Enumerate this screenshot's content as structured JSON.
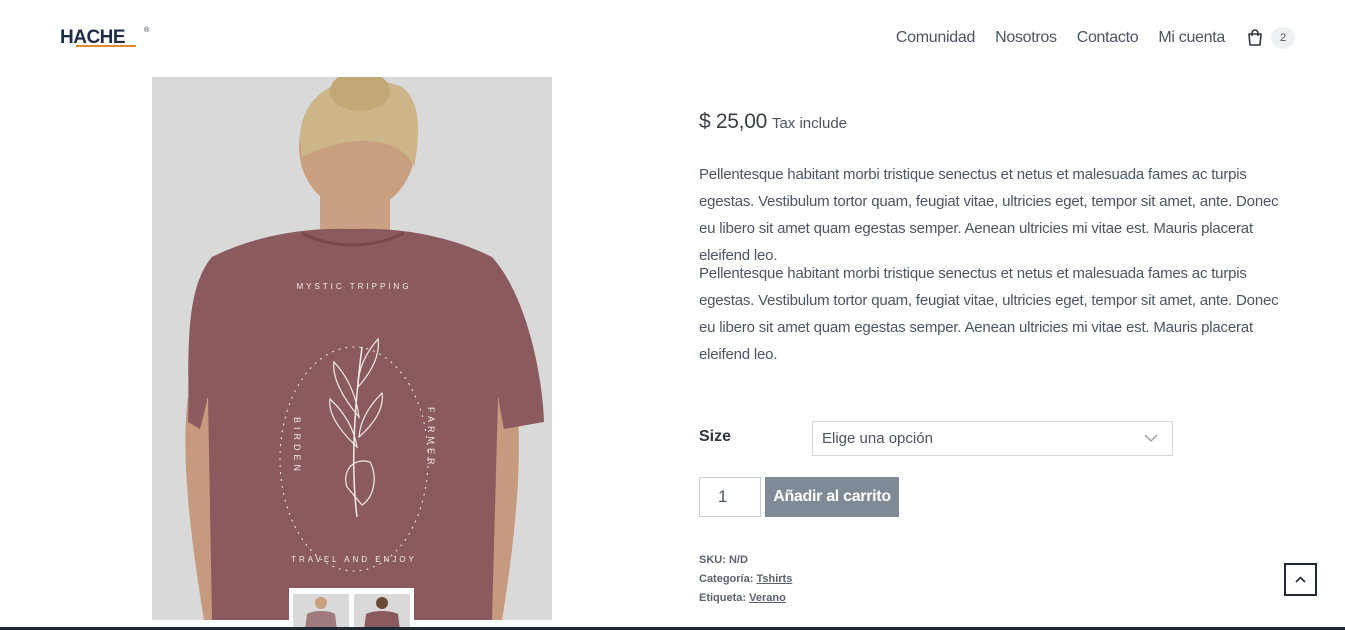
{
  "brand": {
    "logo_text": "HACHE",
    "logo_mark": "®"
  },
  "nav": {
    "items": [
      "Comunidad",
      "Nosotros",
      "Contacto",
      "Mi cuenta"
    ],
    "cart_count": "2",
    "cart_icon": "cart-icon"
  },
  "product": {
    "price": "$ 25,00",
    "tax_note": "Tax include",
    "description_1": "Pellentesque habitant morbi tristique senectus et netus et malesuada fames ac turpis egestas. Vestibulum tortor quam, feugiat vitae, ultricies eget, tempor sit amet, ante. Donec eu libero sit amet quam egestas semper. Aenean ultricies mi vitae est. Mauris placerat eleifend leo.",
    "description_2": "Pellentesque habitant morbi tristique senectus et netus et malesuada fames ac turpis egestas. Vestibulum tortor quam, feugiat vitae, ultricies eget, tempor sit amet, ante. Donec eu libero sit amet quam egestas semper. Aenean ultricies mi vitae est. Mauris placerat eleifend leo.",
    "size_label": "Size",
    "size_placeholder": "Elige una opción",
    "quantity": "1",
    "add_to_cart": "Añadir al carrito",
    "sku_label": "SKU:",
    "sku_value": "N/D",
    "category_label": "Categoría:",
    "category_value": "Tshirts",
    "tag_label": "Etiqueta:",
    "tag_value": "Verano",
    "print_text": {
      "top": "MYSTIC TRIPPING",
      "left": "BIRDEN",
      "right": "FARMER",
      "bottom": "TRAVEL AND ENJOY"
    }
  },
  "colors": {
    "shirt": "#8b5a5f",
    "button": "#7e8a96",
    "logo": "#1f2d44",
    "logo_accent": "#e08a2c"
  }
}
